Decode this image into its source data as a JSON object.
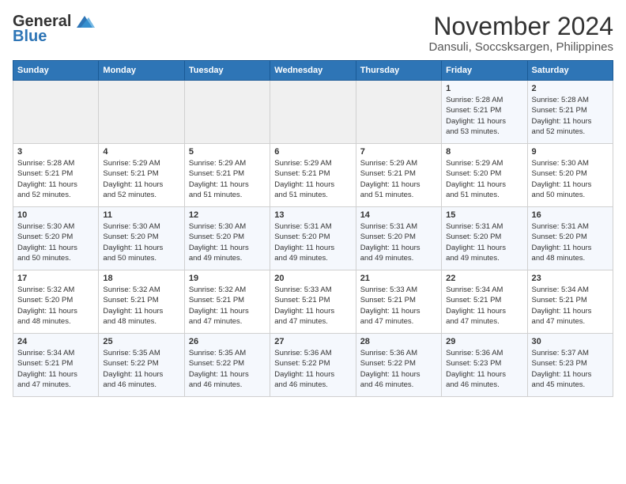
{
  "header": {
    "logo_general": "General",
    "logo_blue": "Blue",
    "month_title": "November 2024",
    "location": "Dansuli, Soccsksargen, Philippines"
  },
  "days_of_week": [
    "Sunday",
    "Monday",
    "Tuesday",
    "Wednesday",
    "Thursday",
    "Friday",
    "Saturday"
  ],
  "weeks": [
    [
      {
        "day": "",
        "info": ""
      },
      {
        "day": "",
        "info": ""
      },
      {
        "day": "",
        "info": ""
      },
      {
        "day": "",
        "info": ""
      },
      {
        "day": "",
        "info": ""
      },
      {
        "day": "1",
        "info": "Sunrise: 5:28 AM\nSunset: 5:21 PM\nDaylight: 11 hours\nand 53 minutes."
      },
      {
        "day": "2",
        "info": "Sunrise: 5:28 AM\nSunset: 5:21 PM\nDaylight: 11 hours\nand 52 minutes."
      }
    ],
    [
      {
        "day": "3",
        "info": "Sunrise: 5:28 AM\nSunset: 5:21 PM\nDaylight: 11 hours\nand 52 minutes."
      },
      {
        "day": "4",
        "info": "Sunrise: 5:29 AM\nSunset: 5:21 PM\nDaylight: 11 hours\nand 52 minutes."
      },
      {
        "day": "5",
        "info": "Sunrise: 5:29 AM\nSunset: 5:21 PM\nDaylight: 11 hours\nand 51 minutes."
      },
      {
        "day": "6",
        "info": "Sunrise: 5:29 AM\nSunset: 5:21 PM\nDaylight: 11 hours\nand 51 minutes."
      },
      {
        "day": "7",
        "info": "Sunrise: 5:29 AM\nSunset: 5:21 PM\nDaylight: 11 hours\nand 51 minutes."
      },
      {
        "day": "8",
        "info": "Sunrise: 5:29 AM\nSunset: 5:20 PM\nDaylight: 11 hours\nand 51 minutes."
      },
      {
        "day": "9",
        "info": "Sunrise: 5:30 AM\nSunset: 5:20 PM\nDaylight: 11 hours\nand 50 minutes."
      }
    ],
    [
      {
        "day": "10",
        "info": "Sunrise: 5:30 AM\nSunset: 5:20 PM\nDaylight: 11 hours\nand 50 minutes."
      },
      {
        "day": "11",
        "info": "Sunrise: 5:30 AM\nSunset: 5:20 PM\nDaylight: 11 hours\nand 50 minutes."
      },
      {
        "day": "12",
        "info": "Sunrise: 5:30 AM\nSunset: 5:20 PM\nDaylight: 11 hours\nand 49 minutes."
      },
      {
        "day": "13",
        "info": "Sunrise: 5:31 AM\nSunset: 5:20 PM\nDaylight: 11 hours\nand 49 minutes."
      },
      {
        "day": "14",
        "info": "Sunrise: 5:31 AM\nSunset: 5:20 PM\nDaylight: 11 hours\nand 49 minutes."
      },
      {
        "day": "15",
        "info": "Sunrise: 5:31 AM\nSunset: 5:20 PM\nDaylight: 11 hours\nand 49 minutes."
      },
      {
        "day": "16",
        "info": "Sunrise: 5:31 AM\nSunset: 5:20 PM\nDaylight: 11 hours\nand 48 minutes."
      }
    ],
    [
      {
        "day": "17",
        "info": "Sunrise: 5:32 AM\nSunset: 5:20 PM\nDaylight: 11 hours\nand 48 minutes."
      },
      {
        "day": "18",
        "info": "Sunrise: 5:32 AM\nSunset: 5:21 PM\nDaylight: 11 hours\nand 48 minutes."
      },
      {
        "day": "19",
        "info": "Sunrise: 5:32 AM\nSunset: 5:21 PM\nDaylight: 11 hours\nand 47 minutes."
      },
      {
        "day": "20",
        "info": "Sunrise: 5:33 AM\nSunset: 5:21 PM\nDaylight: 11 hours\nand 47 minutes."
      },
      {
        "day": "21",
        "info": "Sunrise: 5:33 AM\nSunset: 5:21 PM\nDaylight: 11 hours\nand 47 minutes."
      },
      {
        "day": "22",
        "info": "Sunrise: 5:34 AM\nSunset: 5:21 PM\nDaylight: 11 hours\nand 47 minutes."
      },
      {
        "day": "23",
        "info": "Sunrise: 5:34 AM\nSunset: 5:21 PM\nDaylight: 11 hours\nand 47 minutes."
      }
    ],
    [
      {
        "day": "24",
        "info": "Sunrise: 5:34 AM\nSunset: 5:21 PM\nDaylight: 11 hours\nand 47 minutes."
      },
      {
        "day": "25",
        "info": "Sunrise: 5:35 AM\nSunset: 5:22 PM\nDaylight: 11 hours\nand 46 minutes."
      },
      {
        "day": "26",
        "info": "Sunrise: 5:35 AM\nSunset: 5:22 PM\nDaylight: 11 hours\nand 46 minutes."
      },
      {
        "day": "27",
        "info": "Sunrise: 5:36 AM\nSunset: 5:22 PM\nDaylight: 11 hours\nand 46 minutes."
      },
      {
        "day": "28",
        "info": "Sunrise: 5:36 AM\nSunset: 5:22 PM\nDaylight: 11 hours\nand 46 minutes."
      },
      {
        "day": "29",
        "info": "Sunrise: 5:36 AM\nSunset: 5:23 PM\nDaylight: 11 hours\nand 46 minutes."
      },
      {
        "day": "30",
        "info": "Sunrise: 5:37 AM\nSunset: 5:23 PM\nDaylight: 11 hours\nand 45 minutes."
      }
    ]
  ]
}
